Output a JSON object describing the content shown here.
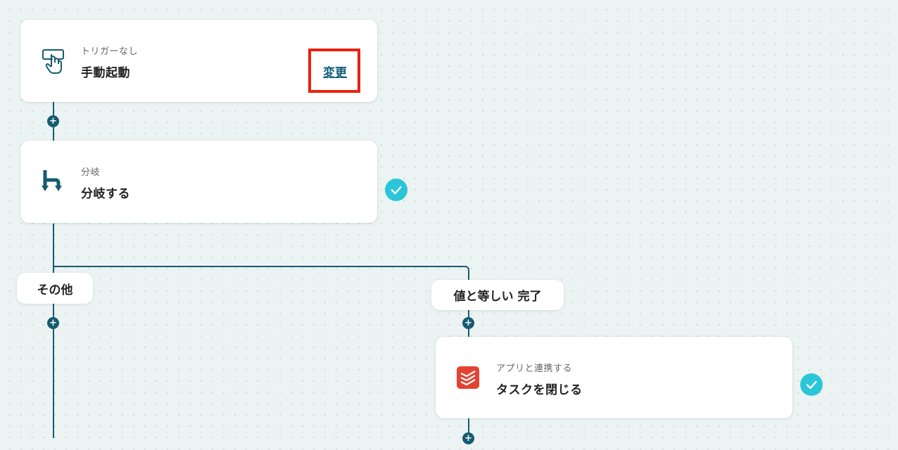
{
  "colors": {
    "line": "#165b71",
    "link": "#0e5d77",
    "check": "#2ac6d8",
    "highlight": "#e8210f",
    "todoist": "#e44332"
  },
  "nodes": {
    "trigger": {
      "subtitle": "トリガーなし",
      "title": "手動起動",
      "change_label": "変更",
      "icon": "hand-pointer-icon"
    },
    "branch": {
      "subtitle": "分岐",
      "title": "分岐する",
      "icon": "branch-icon"
    },
    "app_action": {
      "subtitle": "アプリと連携する",
      "title": "タスクを閉じる",
      "icon": "todoist-icon"
    }
  },
  "branches": {
    "other_label": "その他",
    "condition_label": "値と等しい 完了"
  },
  "add_step_symbol": "+"
}
